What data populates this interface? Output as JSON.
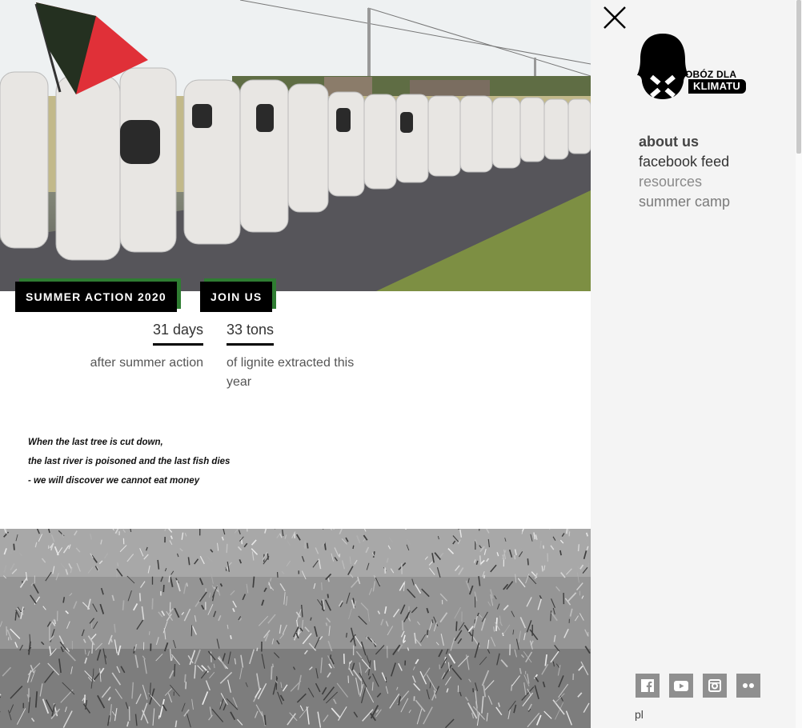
{
  "hero": {
    "tags": {
      "summer_action": "SUMMER ACTION 2020",
      "join_us": "JOIN US"
    }
  },
  "stats": [
    {
      "value": "31 days",
      "description": "after summer action"
    },
    {
      "value": "33 tons",
      "description": "of lignite extracted this year"
    }
  ],
  "quote": {
    "lines": [
      "When the last tree is cut down,",
      "the last river is poisoned and the last fish dies",
      "- we will discover we cannot eat money"
    ]
  },
  "sidebar": {
    "logo": {
      "line1": "OBÓZ DLA",
      "line2": "KLIMATU"
    },
    "menu": [
      {
        "label": "about us"
      },
      {
        "label": "facebook feed"
      },
      {
        "label": "resources"
      },
      {
        "label": "summer camp"
      }
    ],
    "social": [
      "facebook-icon",
      "youtube-icon",
      "instagram-icon",
      "flickr-icon"
    ],
    "language": "pl"
  },
  "colors": {
    "accent": "#2f7d32",
    "panel_bg": "#f4f4f4",
    "social_bg": "#8f8f8f"
  }
}
